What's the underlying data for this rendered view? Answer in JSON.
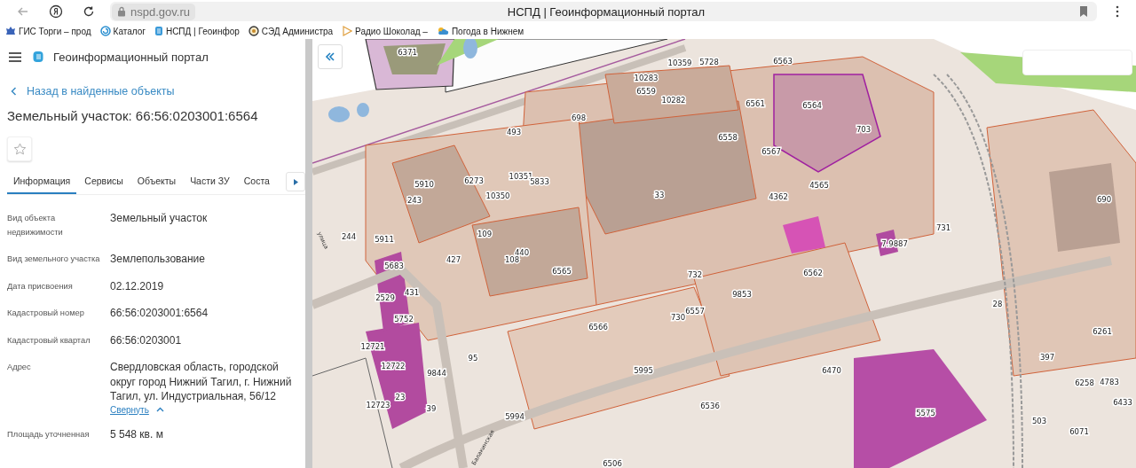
{
  "browser": {
    "url": "nspd.gov.ru",
    "title": "НСПД | Геоинформационный портал"
  },
  "bookmarks": [
    {
      "label": "ГИС Торги – прод",
      "kind": "emblem"
    },
    {
      "label": "Каталог",
      "kind": "swirl"
    },
    {
      "label": "НСПД | Геоинфор",
      "kind": "pages"
    },
    {
      "label": "СЭД Администра",
      "kind": "seal"
    },
    {
      "label": "Радио Шоколад –",
      "kind": "play"
    },
    {
      "label": "Погода в Нижнем",
      "kind": "weather"
    }
  ],
  "app": {
    "title": "Геоинформационный портал"
  },
  "panel": {
    "back_link": "Назад в найденные объекты",
    "heading": "Земельный участок: 66:56:0203001:6564",
    "favorite": false,
    "tabs": [
      {
        "label": "Информация",
        "selected": true
      },
      {
        "label": "Сервисы",
        "selected": false
      },
      {
        "label": "Объекты",
        "selected": false
      },
      {
        "label": "Части ЗУ",
        "selected": false
      },
      {
        "label": "Соста",
        "selected": false
      }
    ],
    "fields": [
      {
        "label": "Вид объекта недвижимости",
        "value": "Земельный участок"
      },
      {
        "label": "Вид земельного участка",
        "value": "Землепользование"
      },
      {
        "label": "Дата присвоения",
        "value": "02.12.2019"
      },
      {
        "label": "Кадастровый номер",
        "value": "66:56:0203001:6564"
      },
      {
        "label": "Кадастровый квартал",
        "value": "66:56:0203001"
      },
      {
        "label": "Адрес",
        "value": "Свердловская область, городской округ город Нижний Тагил, г. Нижний Тагил, ул. Индустриальная, 56/12",
        "toggle": "Свернуть"
      },
      {
        "label": "Площадь уточненная",
        "value": "5 548 кв. м"
      }
    ]
  },
  "map": {
    "parcel_labels": [
      "6371",
      "10359",
      "5728",
      "6563",
      "10283",
      "6559",
      "10282",
      "698",
      "6561",
      "6564",
      "703",
      "493",
      "6558",
      "6567",
      "5910",
      "6273",
      "10351",
      "5833",
      "243",
      "10350",
      "33",
      "4362",
      "4565",
      "690",
      "244",
      "5911",
      "109",
      "440",
      "427",
      "108",
      "6565",
      "731",
      "7.9887",
      "5683",
      "431",
      "732",
      "6562",
      "9853",
      "2529",
      "5752",
      "6557",
      "730",
      "28",
      "6566",
      "6261",
      "12721",
      "397",
      "95",
      "9844",
      "12722",
      "5995",
      "6470",
      "6258",
      "4783",
      "23",
      "39",
      "6536",
      "5575",
      "6433",
      "12723",
      "5994",
      "503",
      "6071",
      "6506"
    ],
    "street_labels": [
      "улица",
      "Балакинская"
    ]
  }
}
